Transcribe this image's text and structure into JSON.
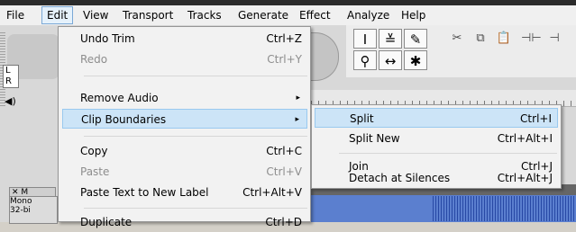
{
  "menubar": {
    "items": [
      "File",
      "Edit",
      "View",
      "Transport",
      "Tracks",
      "Generate",
      "Effect",
      "Analyze",
      "Help"
    ]
  },
  "edit_menu": {
    "items": [
      {
        "label": "Undo Trim",
        "shortcut": "Ctrl+Z",
        "enabled": true
      },
      {
        "label": "Redo",
        "shortcut": "Ctrl+Y",
        "enabled": false
      },
      {
        "label": "Remove Audio",
        "has_submenu": true,
        "enabled": true
      },
      {
        "label": "Clip Boundaries",
        "has_submenu": true,
        "enabled": true,
        "highlighted": true
      },
      {
        "label": "Copy",
        "shortcut": "Ctrl+C",
        "enabled": true
      },
      {
        "label": "Paste",
        "shortcut": "Ctrl+V",
        "enabled": false
      },
      {
        "label": "Paste Text to New Label",
        "shortcut": "Ctrl+Alt+V",
        "enabled": true
      },
      {
        "label": "Duplicate",
        "shortcut": "Ctrl+D",
        "enabled": true
      }
    ]
  },
  "clip_boundaries_submenu": {
    "items": [
      {
        "label": "Split",
        "shortcut": "Ctrl+I",
        "highlighted": true
      },
      {
        "label": "Split New",
        "shortcut": "Ctrl+Alt+I"
      },
      {
        "label": "Join",
        "shortcut": "Ctrl+J"
      },
      {
        "label": "Detach at Silences",
        "shortcut": "Ctrl+Alt+J"
      }
    ]
  },
  "background": {
    "meter_left": "L",
    "meter_right": "R",
    "track_close": "✕ M",
    "track_line1": "Mono",
    "track_line2": "32-bi"
  },
  "icons": {
    "arrow": "▸",
    "speaker": "◀)",
    "ibeam": "I",
    "envelope": "≚",
    "draw": "✎",
    "zoom": "⚲",
    "timeshift": "↔",
    "multi": "✱",
    "cut": "✂",
    "copy": "⧉",
    "paste": "📋",
    "trim": "⊣⊢",
    "silence": "⊣"
  }
}
